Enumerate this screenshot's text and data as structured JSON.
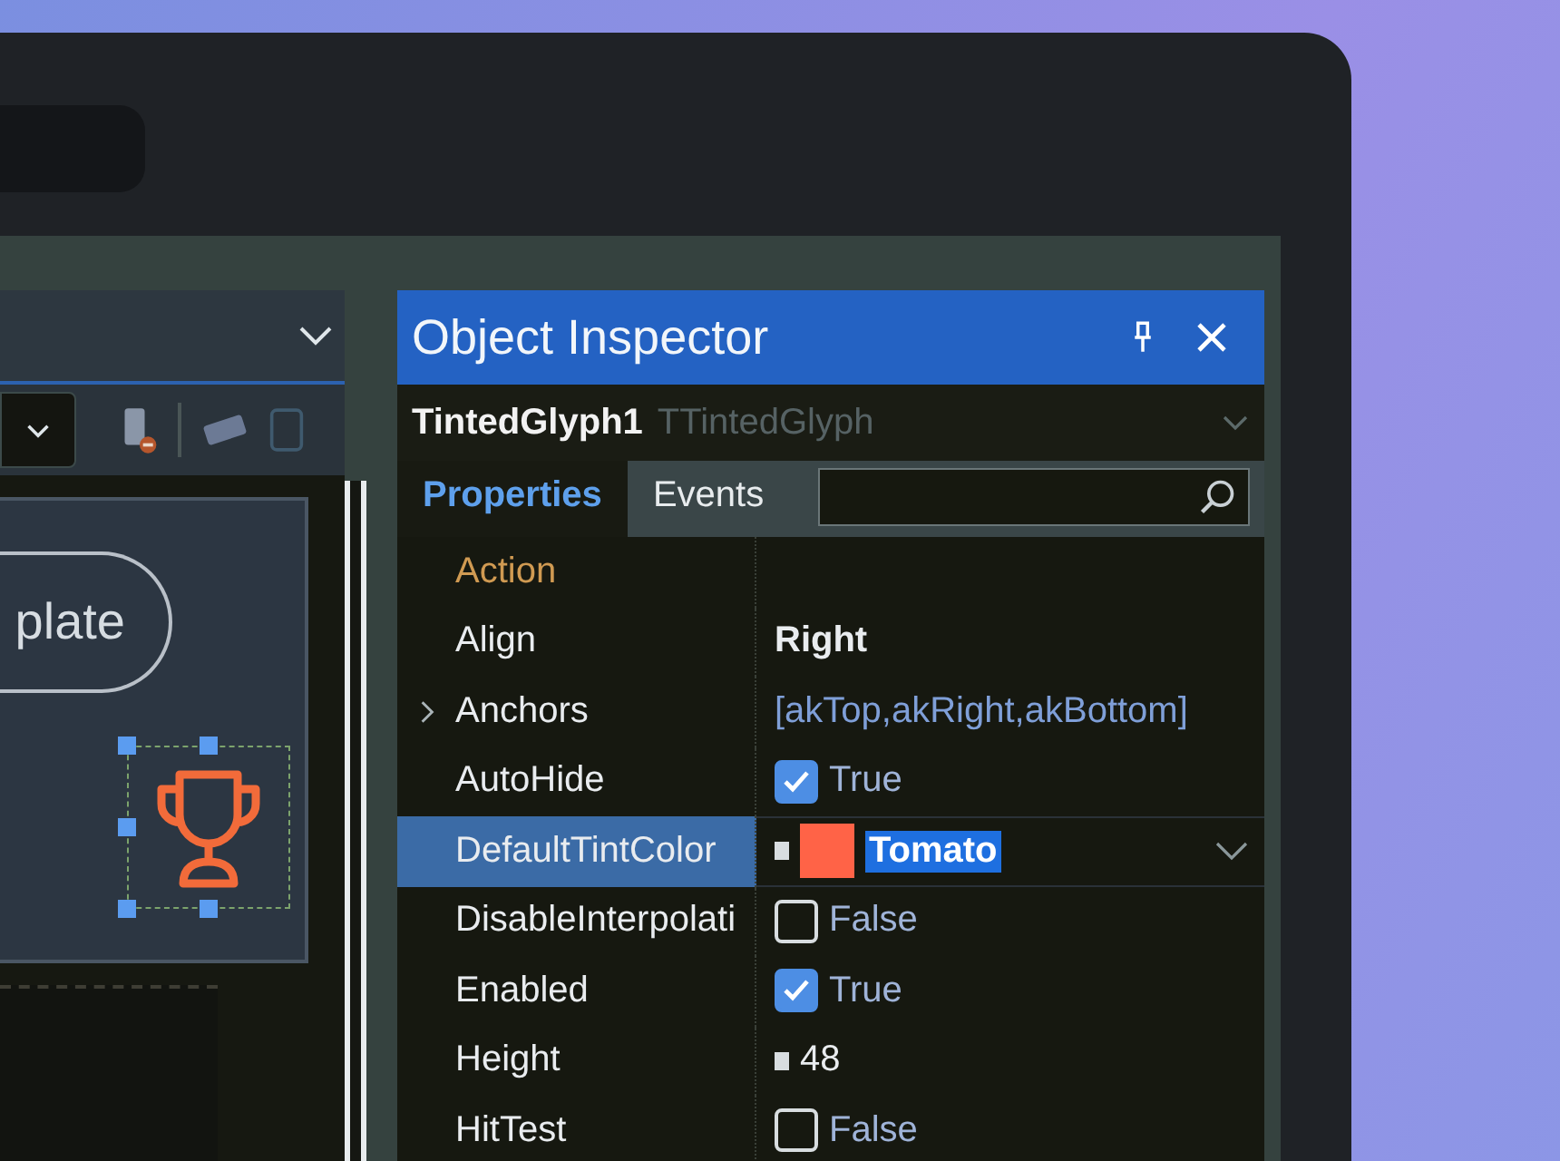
{
  "designer": {
    "button_text": "plate"
  },
  "inspector": {
    "title": "Object Inspector",
    "component": {
      "name": "TintedGlyph1",
      "type": "TTintedGlyph"
    },
    "tabs": [
      {
        "label": "Properties",
        "selected": true
      },
      {
        "label": "Events",
        "selected": false
      }
    ],
    "properties": [
      {
        "name": "Action",
        "kind": "empty",
        "linked": true,
        "expandable": false,
        "selected": false
      },
      {
        "name": "Align",
        "kind": "enum",
        "value": "Right",
        "linked": false,
        "expandable": false,
        "selected": false
      },
      {
        "name": "Anchors",
        "kind": "set",
        "value": "[akTop,akRight,akBottom]",
        "linked": false,
        "expandable": true,
        "selected": false
      },
      {
        "name": "AutoHide",
        "kind": "checkbox",
        "value": "True",
        "checked": true,
        "linked": false,
        "expandable": false,
        "selected": false
      },
      {
        "name": "DefaultTintColor",
        "kind": "color",
        "value": "Tomato",
        "color": "#ff6347",
        "linked": false,
        "expandable": false,
        "selected": true
      },
      {
        "name": "DisableInterpolati",
        "kind": "checkbox",
        "value": "False",
        "checked": false,
        "linked": false,
        "expandable": false,
        "selected": false
      },
      {
        "name": "Enabled",
        "kind": "checkbox",
        "value": "True",
        "checked": true,
        "linked": false,
        "expandable": false,
        "selected": false
      },
      {
        "name": "Height",
        "kind": "number",
        "value": "48",
        "linked": false,
        "expandable": false,
        "selected": false
      },
      {
        "name": "HitTest",
        "kind": "checkbox",
        "value": "False",
        "checked": false,
        "linked": false,
        "expandable": false,
        "selected": false
      }
    ]
  }
}
